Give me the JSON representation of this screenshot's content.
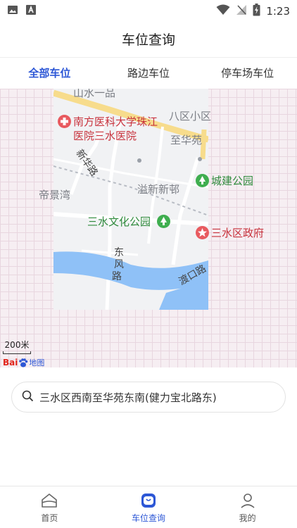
{
  "status_bar": {
    "time": "1:23",
    "left_icons": [
      "image-icon",
      "font-icon"
    ],
    "right_icons": [
      "wifi-icon",
      "no-signal-icon",
      "battery-charging-icon"
    ]
  },
  "header": {
    "title": "车位查询"
  },
  "tabs": [
    {
      "label": "全部车位",
      "active": true
    },
    {
      "label": "路边车位",
      "active": false
    },
    {
      "label": "停车场车位",
      "active": false
    }
  ],
  "map": {
    "labels": {
      "shanshui": "山水一品",
      "hospital_line1": "南方医科大学珠江",
      "hospital_line2": "医院三水医院",
      "baqu": "八区小区",
      "zhihuayuan": "至华苑",
      "xinhualu": "新华路",
      "chengjian_park": "城建公园",
      "dijingwan": "帝景湾",
      "yixin": "溢新新邨",
      "wenhua_park": "三水文化公园",
      "government": "三水区政府",
      "dongfenglu": "东风路",
      "dukoulu": "渡口路"
    },
    "scale_label": "200米",
    "logo": {
      "bai": "Bai",
      "du": "du",
      "map_word": "地图"
    }
  },
  "address": {
    "text": "三水区西南至华苑东南(健力宝北路东)"
  },
  "bottom_nav": [
    {
      "label": "首页",
      "icon": "home-icon",
      "active": false
    },
    {
      "label": "车位查询",
      "icon": "parking-search-icon",
      "active": true
    },
    {
      "label": "我的",
      "icon": "user-icon",
      "active": false
    }
  ],
  "colors": {
    "accent": "#2d57d6",
    "map_grid_bg": "#f6eef2",
    "water": "#8fc1f7",
    "road_highlight": "#f7dc8c",
    "poi_red": "#e85a5f",
    "poi_green": "#3fae4f"
  }
}
